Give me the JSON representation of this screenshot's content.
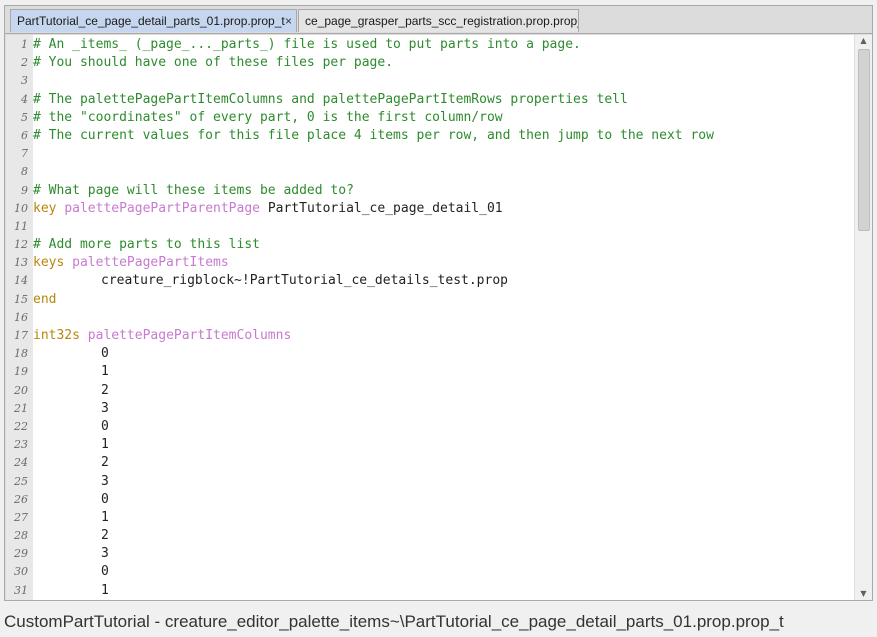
{
  "tabs": [
    {
      "label": "PartTutorial_ce_page_detail_parts_01.prop.prop_t",
      "active": true,
      "close": "×"
    },
    {
      "label": "ce_page_grasper_parts_scc_registration.prop.prop_t",
      "active": false
    }
  ],
  "editor": {
    "lines": [
      {
        "n": "1",
        "type": "comment",
        "text": "# An _items_ (_page_..._parts_) file is used to put parts into a page."
      },
      {
        "n": "2",
        "type": "comment",
        "text": "# You should have one of these files per page."
      },
      {
        "n": "3",
        "type": "empty",
        "text": ""
      },
      {
        "n": "4",
        "type": "comment",
        "text": "# The palettePagePartItemColumns and palettePagePartItemRows properties tell"
      },
      {
        "n": "5",
        "type": "comment",
        "text": "# the \"coordinates\" of every part, 0 is the first column/row"
      },
      {
        "n": "6",
        "type": "comment",
        "text": "# The current values for this file place 4 items per row, and then jump to the next row"
      },
      {
        "n": "7",
        "type": "empty",
        "text": ""
      },
      {
        "n": "8",
        "type": "empty",
        "text": ""
      },
      {
        "n": "9",
        "type": "comment",
        "text": "# What page will these items be added to?"
      },
      {
        "n": "10",
        "type": "decl",
        "kw": "key",
        "prop": "palettePagePartParentPage",
        "val": "PartTutorial_ce_page_detail_01"
      },
      {
        "n": "11",
        "type": "empty",
        "text": ""
      },
      {
        "n": "12",
        "type": "comment",
        "text": "# Add more parts to this list"
      },
      {
        "n": "13",
        "type": "decl",
        "kw": "keys",
        "prop": "palettePagePartItems",
        "val": ""
      },
      {
        "n": "14",
        "type": "item",
        "text": "creature_rigblock~!PartTutorial_ce_details_test.prop"
      },
      {
        "n": "15",
        "type": "kwonly",
        "text": "end"
      },
      {
        "n": "16",
        "type": "empty",
        "text": ""
      },
      {
        "n": "17",
        "type": "decl",
        "kw": "int32s",
        "prop": "palettePagePartItemColumns",
        "val": ""
      },
      {
        "n": "18",
        "type": "item",
        "text": "0"
      },
      {
        "n": "19",
        "type": "item",
        "text": "1"
      },
      {
        "n": "20",
        "type": "item",
        "text": "2"
      },
      {
        "n": "21",
        "type": "item",
        "text": "3"
      },
      {
        "n": "22",
        "type": "item",
        "text": "0"
      },
      {
        "n": "23",
        "type": "item",
        "text": "1"
      },
      {
        "n": "24",
        "type": "item",
        "text": "2"
      },
      {
        "n": "25",
        "type": "item",
        "text": "3"
      },
      {
        "n": "26",
        "type": "item",
        "text": "0"
      },
      {
        "n": "27",
        "type": "item",
        "text": "1"
      },
      {
        "n": "28",
        "type": "item",
        "text": "2"
      },
      {
        "n": "29",
        "type": "item",
        "text": "3"
      },
      {
        "n": "30",
        "type": "item",
        "text": "0"
      },
      {
        "n": "31",
        "type": "item",
        "text": "1"
      }
    ]
  },
  "status_bar": {
    "path": "CustomPartTutorial - creature_editor_palette_items~\\PartTutorial_ce_page_detail_parts_01.prop.prop_t"
  },
  "colors": {
    "comment": "#2e8b2e",
    "keyword": "#b8860b",
    "property": "#c87ad0",
    "active_tab": "#c5d6ee"
  }
}
